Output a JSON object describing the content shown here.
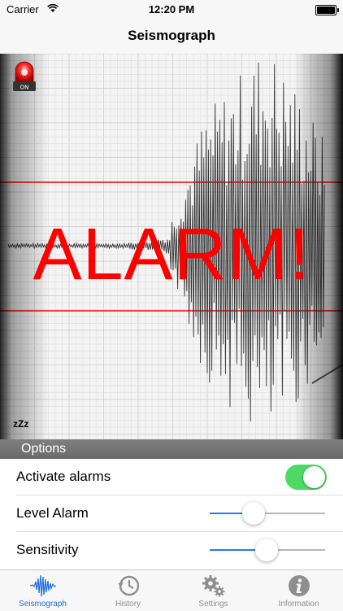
{
  "status_bar": {
    "carrier": "Carrier",
    "time": "12:20 PM"
  },
  "navbar": {
    "title": "Seismograph"
  },
  "seismograph": {
    "alarm_text": "ALARM!",
    "siren_label": "ON",
    "sleep_label": "zZz"
  },
  "options": {
    "header": "Options",
    "rows": [
      {
        "label": "Activate alarms",
        "toggle_on": true
      },
      {
        "label": "Level Alarm",
        "slider_value": 0.38
      },
      {
        "label": "Sensitivity",
        "slider_value": 0.49
      }
    ]
  },
  "tabs": [
    {
      "label": "Seismograph",
      "icon": "waveform-icon",
      "active": true
    },
    {
      "label": "History",
      "icon": "history-icon",
      "active": false
    },
    {
      "label": "Settings",
      "icon": "gears-icon",
      "active": false
    },
    {
      "label": "Information",
      "icon": "info-icon",
      "active": false
    }
  ],
  "colors": {
    "alarm": "#ff0000",
    "accent": "#1a6fe0",
    "toggle_on": "#4cd964"
  }
}
